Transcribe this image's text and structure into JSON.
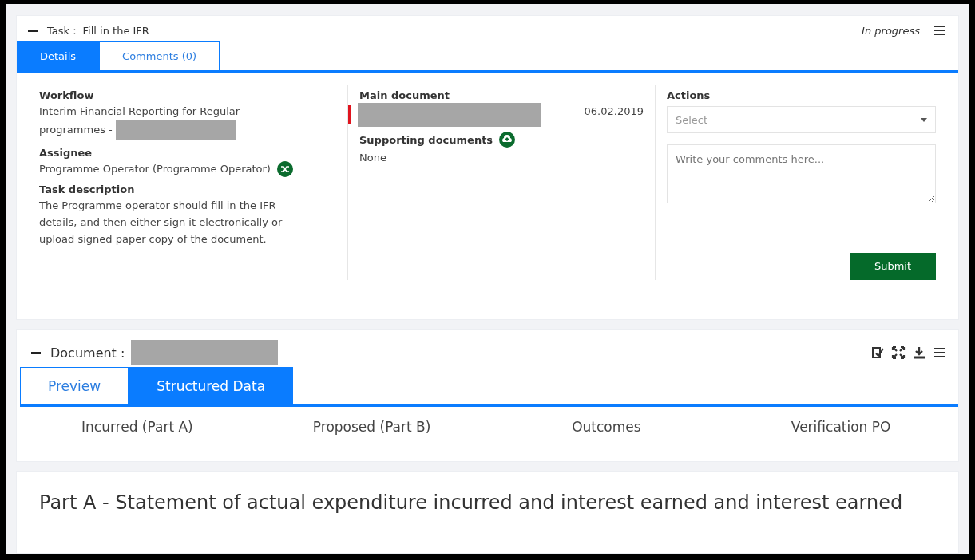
{
  "task": {
    "label": "Task :",
    "title": "Fill in the IFR",
    "status": "In progress",
    "tabs": [
      {
        "label": "Details",
        "selected": true
      },
      {
        "label": "Comments (0)",
        "selected": false
      }
    ],
    "workflow": {
      "label": "Workflow",
      "value": "Interim Financial Reporting for Regular programmes -"
    },
    "assignee": {
      "label": "Assignee",
      "value": "Programme Operator (Programme Operator)"
    },
    "description": {
      "label": "Task description",
      "value": "The Programme operator should fill in the IFR details, and then either sign it electronically or upload signed paper copy of the document."
    },
    "main_document": {
      "label": "Main document",
      "date": "06.02.2019"
    },
    "supporting_documents": {
      "label": "Supporting documents",
      "value": "None"
    },
    "actions": {
      "label": "Actions",
      "select_placeholder": "Select",
      "comment_placeholder": "Write your comments here...",
      "submit": "Submit"
    }
  },
  "document": {
    "label": "Document :",
    "tabs": [
      {
        "label": "Preview",
        "selected": false
      },
      {
        "label": "Structured Data",
        "selected": true
      }
    ],
    "sections": [
      "Incurred (Part A)",
      "Proposed (Part B)",
      "Outcomes",
      "Verification PO"
    ]
  },
  "part_heading": "Part A - Statement of actual expenditure incurred and interest earned and interest earned"
}
